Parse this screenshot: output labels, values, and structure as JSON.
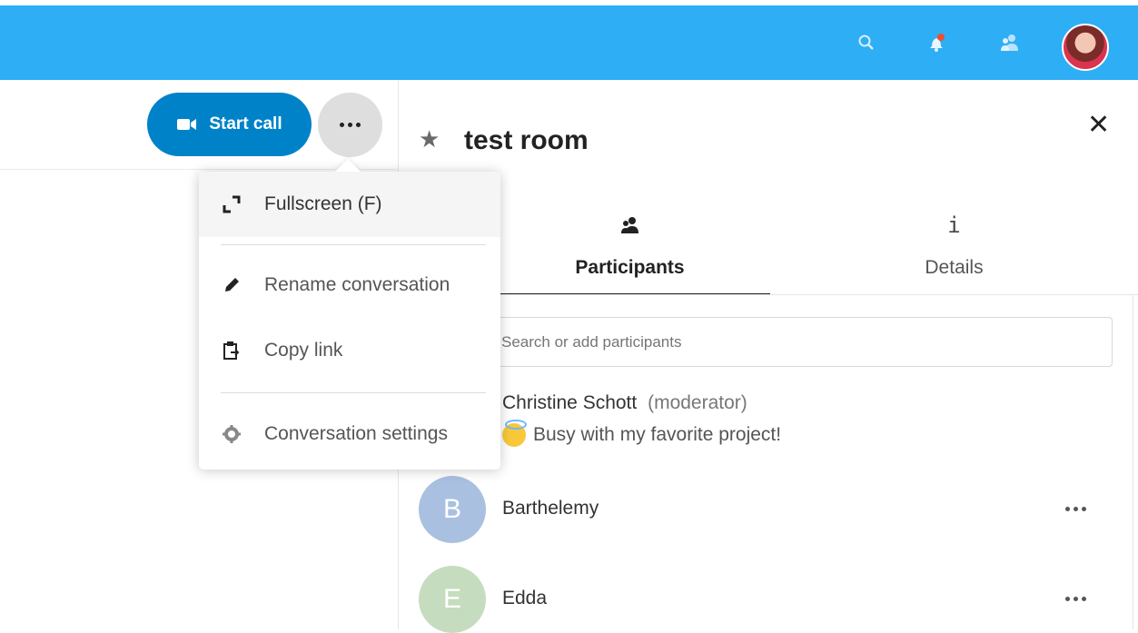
{
  "header": {
    "icons": [
      "search-icon",
      "notifications-icon",
      "contacts-icon"
    ],
    "notification_dot_color": "#ee4d2e",
    "brand_color": "#2eaef5"
  },
  "call": {
    "start_call_label": "Start call",
    "accent": "#0082c9"
  },
  "menu": {
    "items": [
      {
        "label": "Fullscreen (F)",
        "icon": "fullscreen-icon"
      },
      {
        "label": "Rename conversation",
        "icon": "pencil-icon"
      },
      {
        "label": "Copy link",
        "icon": "clipboard-icon"
      },
      {
        "label": "Conversation settings",
        "icon": "gear-icon"
      }
    ]
  },
  "room": {
    "title": "test room"
  },
  "tabs": [
    {
      "label": "Participants",
      "icon": "participants-icon"
    },
    {
      "label": "Details",
      "icon": "info-icon"
    }
  ],
  "search": {
    "placeholder": "Search or add participants"
  },
  "participants": [
    {
      "name": "Christine Schott",
      "role": "(moderator)",
      "status": "Busy with my favorite project!"
    },
    {
      "name": "Barthelemy",
      "initial": "B",
      "color": "#a9c0e0"
    },
    {
      "name": "Edda",
      "initial": "E",
      "color": "#c6dcbf"
    }
  ]
}
